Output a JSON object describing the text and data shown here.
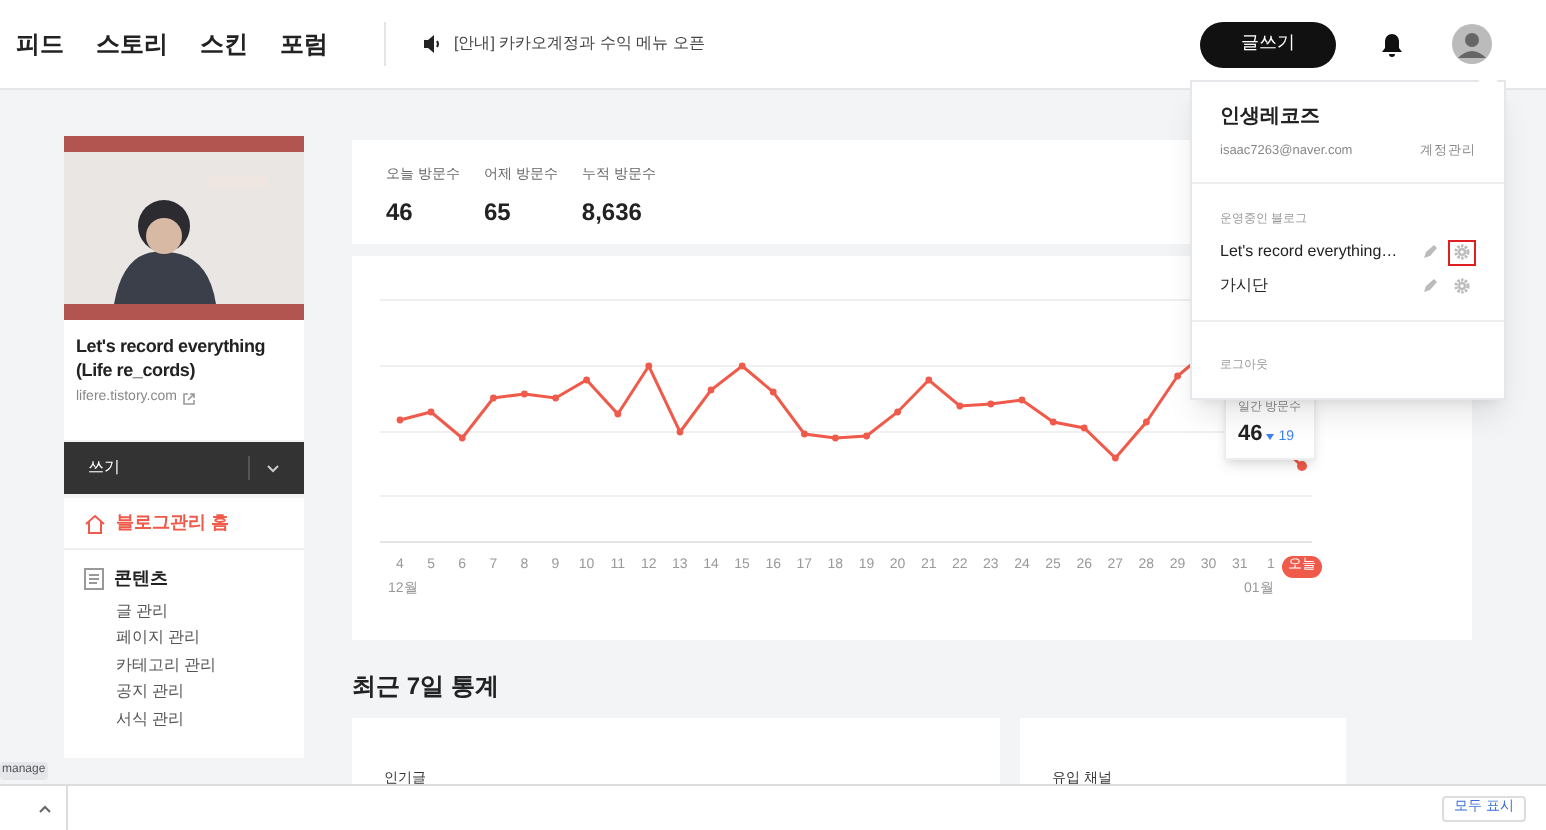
{
  "nav": {
    "links": [
      "피드",
      "스토리",
      "스킨",
      "포럼"
    ],
    "notice": "[안내] 카카오계정과 수익 메뉴 오픈",
    "write_button": "글쓰기"
  },
  "sidebar": {
    "blog_title": "Let's record everything (Life re_cords)",
    "blog_url": "lifere.tistory.com",
    "write_label": "쓰기",
    "home": "블로그관리 홈",
    "section": "콘텐츠",
    "items": [
      "글 관리",
      "페이지 관리",
      "카테고리 관리",
      "공지 관리",
      "서식 관리"
    ]
  },
  "stats": [
    {
      "label": "오늘 방문수",
      "value": "46"
    },
    {
      "label": "어제 방문수",
      "value": "65"
    },
    {
      "label": "누적 방문수",
      "value": "8,636"
    }
  ],
  "chart": {
    "x_labels": [
      "4",
      "5",
      "6",
      "7",
      "8",
      "9",
      "10",
      "11",
      "12",
      "13",
      "14",
      "15",
      "16",
      "17",
      "18",
      "19",
      "20",
      "21",
      "22",
      "23",
      "24",
      "25",
      "26",
      "27",
      "28",
      "29",
      "30",
      "31",
      "1"
    ],
    "today_label": "오늘",
    "month_start": "12월",
    "month_end": "01월",
    "tooltip": {
      "label": "일간 방문수",
      "value": "46",
      "change": "19"
    }
  },
  "recent": {
    "title": "최근 7일 통계",
    "cards": [
      "인기글",
      "유입 채널"
    ]
  },
  "account_menu": {
    "name": "인생레코즈",
    "email": "isaac7263@naver.com",
    "manage": "계정관리",
    "section": "운영중인 블로그",
    "blogs": [
      {
        "name": "Let's record everything…",
        "highlighted": true
      },
      {
        "name": "가시단",
        "highlighted": false
      }
    ],
    "logout": "로그아웃"
  },
  "taskbar": {
    "tab": "manage",
    "show_all": "모두 표시"
  }
}
